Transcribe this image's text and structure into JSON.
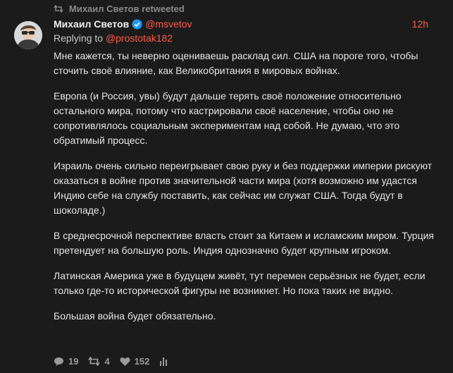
{
  "retweet": {
    "text": "Михаил Светов retweeted"
  },
  "tweet": {
    "name": "Михаил Светов",
    "handle": "@msvetov",
    "time": "12h",
    "replying_prefix": "Replying to ",
    "replying_to": "@prostotak182",
    "paragraphs": [
      "Мне кажется, ты неверно оцениваешь расклад сил. США на пороге того, чтобы сточить своё влияние, как Великобритания в мировых войнах.",
      "Европа (и Россия, увы) будут дальше терять своё положение относительно остального мира, потому что кастрировали своё население, чтобы оно не сопротивлялось социальным экспериментам над собой. Не думаю, что это обратимый процесс.",
      "Израиль очень сильно переигрывает свою руку и без поддержки империи рискуют оказаться в войне против значительной части мира (хотя возможно им удастся Индию себе на службу поставить, как сейчас им служат США. Тогда будут в шоколаде.)",
      "В среднесрочной перспективе власть стоит за Китаем и исламским миром. Турция претендует на большую роль. Индия однозначно будет крупным игроком.",
      "Латинская Америка уже в будущем живёт, тут перемен серьёзных не будет, если только где-то исторической фигуры не возникнет. Но пока таких не видно.",
      "Большая война будет обязательно."
    ]
  },
  "actions": {
    "replies": "19",
    "retweets": "4",
    "likes": "152"
  },
  "colors": {
    "background": "#1b1b1b",
    "accent": "#ff5a49",
    "muted": "#8a8a8a",
    "verified": "#1d9bf0"
  },
  "icons": [
    "retweet-icon",
    "verified-icon",
    "reply-icon",
    "like-icon",
    "stats-icon"
  ]
}
